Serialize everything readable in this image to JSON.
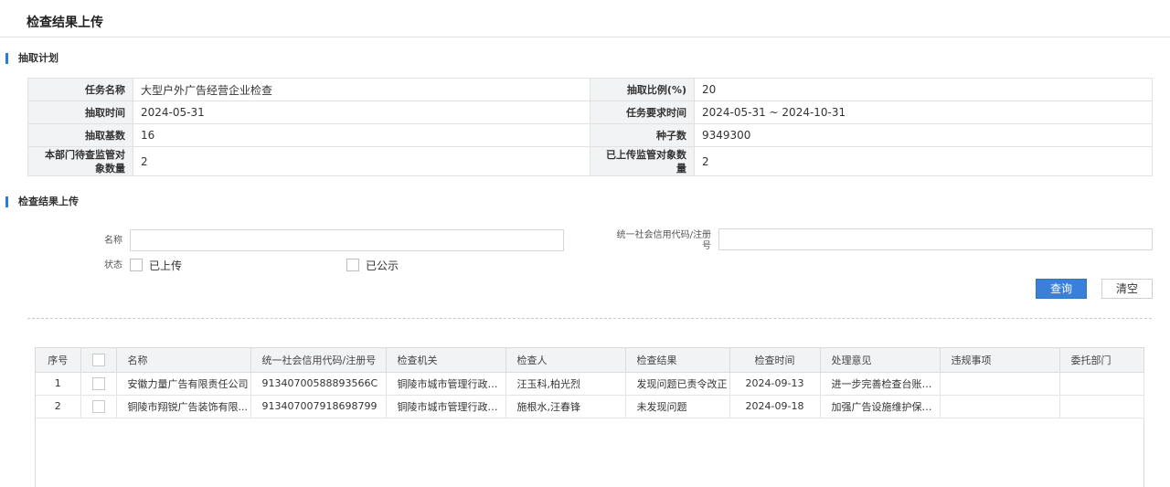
{
  "page": {
    "title": "检查结果上传"
  },
  "plan_section": {
    "title": "抽取计划",
    "rows": [
      {
        "label_left": "任务名称",
        "value_left": "大型户外广告经营企业检查",
        "label_right": "抽取比例(%)",
        "value_right": "20"
      },
      {
        "label_left": "抽取时间",
        "value_left": "2024-05-31",
        "label_right": "任务要求时间",
        "value_right": "2024-05-31 ~ 2024-10-31"
      },
      {
        "label_left": "抽取基数",
        "value_left": "16",
        "label_right": "种子数",
        "value_right": "9349300"
      },
      {
        "label_left": "本部门待查监管对象数量",
        "value_left": "2",
        "label_right": "已上传监管对象数量",
        "value_right": "2"
      }
    ]
  },
  "upload_section": {
    "title": "检查结果上传"
  },
  "search_form": {
    "name_label": "名称",
    "name_value": "",
    "credit_code_label": "统一社会信用代码/注册号",
    "credit_code_value": "",
    "status_label": "状态",
    "status_options": [
      {
        "label": "已上传",
        "checked": false
      },
      {
        "label": "已公示",
        "checked": false
      }
    ],
    "query_button": "查询",
    "clear_button": "清空"
  },
  "grid": {
    "columns": [
      "序号",
      "",
      "名称",
      "统一社会信用代码/注册号",
      "检查机关",
      "检查人",
      "检查结果",
      "检查时间",
      "处理意见",
      "违规事项",
      "委托部门"
    ],
    "rows": [
      {
        "index": "1",
        "name": "安徽力量广告有限责任公司",
        "credit_code": "91340700588893566C",
        "authority": "铜陵市城市管理行政执...",
        "inspector": "汪玉科,柏光烈",
        "result": "发现问题已责令改正",
        "date": "2024-09-13",
        "opinion": "进一步完善检查台账；...",
        "violation": "",
        "department": ""
      },
      {
        "index": "2",
        "name": "铜陵市翔锐广告装饰有限...",
        "credit_code": "913407007918698799",
        "authority": "铜陵市城市管理行政执...",
        "inspector": "施根水,汪春锋",
        "result": "未发现问题",
        "date": "2024-09-18",
        "opinion": "加强广告设施维护保养...",
        "violation": "",
        "department": ""
      }
    ]
  },
  "colors": {
    "accent": "#3a80d8",
    "section_bar": "#2b7bd0",
    "label_bg": "#f2f3f5"
  }
}
